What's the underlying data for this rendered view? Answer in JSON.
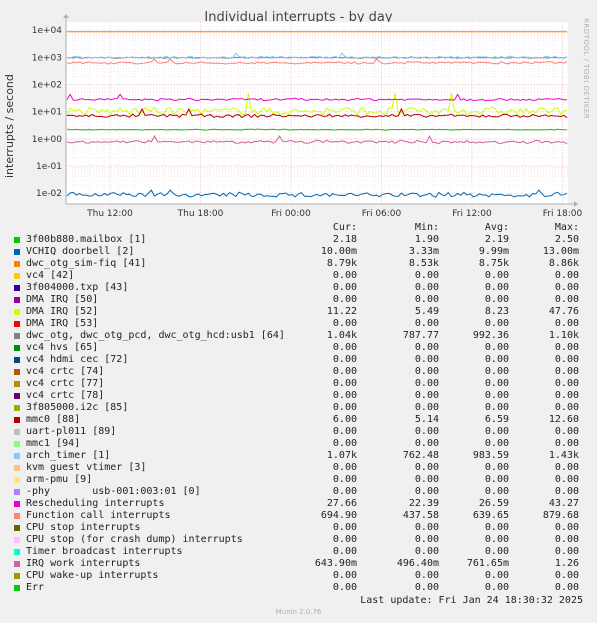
{
  "chart_data": {
    "type": "line",
    "title": "Individual interrupts - by day",
    "ylabel": "interrupts / second",
    "yscale": "log",
    "ylim": [
      0.004,
      20000
    ],
    "yticks": [
      "1e-02",
      "1e-01",
      "1e+00",
      "1e+01",
      "1e+02",
      "1e+03",
      "1e+04"
    ],
    "xticks": [
      "Thu 12:00",
      "Thu 18:00",
      "Fri 00:00",
      "Fri 06:00",
      "Fri 12:00",
      "Fri 18:00"
    ],
    "grid": true,
    "series": [
      {
        "name": "3f00b880.mailbox [1]",
        "color": "#00cc00",
        "values": [
          2.18,
          1.9,
          2.19,
          2.5
        ]
      },
      {
        "name": "VCHIQ doorbell [2]",
        "color": "#0066b3",
        "values": [
          0.01,
          0.00333,
          0.00999,
          0.013
        ]
      },
      {
        "name": "dwc_otg_sim-fiq [41]",
        "color": "#ff8000",
        "values": [
          8790,
          8530,
          8750,
          8860
        ]
      },
      {
        "name": "vc4 [42]",
        "color": "#ffcc00",
        "values": [
          0,
          0,
          0,
          0
        ]
      },
      {
        "name": "3f004000.txp [43]",
        "color": "#330099",
        "values": [
          0,
          0,
          0,
          0
        ]
      },
      {
        "name": "DMA IRQ [50]",
        "color": "#990099",
        "values": [
          0,
          0,
          0,
          0
        ]
      },
      {
        "name": "DMA IRQ [52]",
        "color": "#ccff00",
        "values": [
          11.22,
          5.49,
          8.23,
          47.76
        ]
      },
      {
        "name": "DMA IRQ [53]",
        "color": "#ff0000",
        "values": [
          0,
          0,
          0,
          0
        ]
      },
      {
        "name": "dwc_otg, dwc_otg_pcd, dwc_otg_hcd:usb1 [64]",
        "color": "#808080",
        "values": [
          1040,
          787.77,
          992.36,
          1100
        ]
      },
      {
        "name": "vc4 hvs [65]",
        "color": "#008f00",
        "values": [
          0,
          0,
          0,
          0
        ]
      },
      {
        "name": "vc4 hdmi cec [72]",
        "color": "#00487d",
        "values": [
          0,
          0,
          0,
          0
        ]
      },
      {
        "name": "vc4 crtc [74]",
        "color": "#b35a00",
        "values": [
          0,
          0,
          0,
          0
        ]
      },
      {
        "name": "vc4 crtc [77]",
        "color": "#b38f00",
        "values": [
          0,
          0,
          0,
          0
        ]
      },
      {
        "name": "vc4 crtc [78]",
        "color": "#6b006b",
        "values": [
          0,
          0,
          0,
          0
        ]
      },
      {
        "name": "3f805000.i2c [85]",
        "color": "#8fb300",
        "values": [
          0,
          0,
          0,
          0
        ]
      },
      {
        "name": "mmc0 [88]",
        "color": "#b30000",
        "values": [
          6.0,
          5.14,
          6.59,
          12.6
        ]
      },
      {
        "name": "uart-pl011 [89]",
        "color": "#bebebe",
        "values": [
          0,
          0,
          0,
          0
        ]
      },
      {
        "name": "mmc1 [94]",
        "color": "#80ff80",
        "values": [
          0,
          0,
          0,
          0
        ]
      },
      {
        "name": "arch_timer [1]",
        "color": "#80c9ff",
        "values": [
          1070,
          762.48,
          983.59,
          1430
        ]
      },
      {
        "name": "kvm guest vtimer [3]",
        "color": "#ffc080",
        "values": [
          0,
          0,
          0,
          0
        ]
      },
      {
        "name": "arm-pmu [9]",
        "color": "#ffe680",
        "values": [
          0,
          0,
          0,
          0
        ]
      },
      {
        "name": "-phy       usb-001:003:01 [0]",
        "color": "#aa80ff",
        "values": [
          0,
          0,
          0,
          0
        ]
      },
      {
        "name": "Rescheduling interrupts",
        "color": "#ee00cc",
        "values": [
          27.66,
          22.39,
          26.59,
          43.27
        ]
      },
      {
        "name": "Function call interrupts",
        "color": "#ff8080",
        "values": [
          694.9,
          437.58,
          639.65,
          879.68
        ]
      },
      {
        "name": "CPU stop interrupts",
        "color": "#666600",
        "values": [
          0,
          0,
          0,
          0
        ]
      },
      {
        "name": "CPU stop (for crash dump) interrupts",
        "color": "#ffbfff",
        "values": [
          0,
          0,
          0,
          0
        ]
      },
      {
        "name": "Timer broadcast interrupts",
        "color": "#00ffcc",
        "values": [
          0,
          0,
          0,
          0
        ]
      },
      {
        "name": "IRQ work interrupts",
        "color": "#cc6699",
        "values": [
          0.6439,
          0.4964,
          0.76165,
          1.26
        ]
      },
      {
        "name": "CPU wake-up interrupts",
        "color": "#999900",
        "values": [
          0,
          0,
          0,
          0
        ]
      },
      {
        "name": "Err",
        "color": "#00cc00",
        "values": [
          0,
          0,
          0,
          0
        ]
      }
    ]
  },
  "legend": {
    "headers": {
      "cur": "Cur:",
      "min": "Min:",
      "avg": "Avg:",
      "max": "Max:"
    },
    "rows": [
      {
        "name": "3f00b880.mailbox [1]",
        "cur": "2.18",
        "min": "1.90",
        "avg": "2.19",
        "max": "2.50"
      },
      {
        "name": "VCHIQ doorbell [2]",
        "cur": "10.00m",
        "min": "3.33m",
        "avg": "9.99m",
        "max": "13.00m"
      },
      {
        "name": "dwc_otg_sim-fiq [41]",
        "cur": "8.79k",
        "min": "8.53k",
        "avg": "8.75k",
        "max": "8.86k"
      },
      {
        "name": "vc4 [42]",
        "cur": "0.00",
        "min": "0.00",
        "avg": "0.00",
        "max": "0.00"
      },
      {
        "name": "3f004000.txp [43]",
        "cur": "0.00",
        "min": "0.00",
        "avg": "0.00",
        "max": "0.00"
      },
      {
        "name": "DMA IRQ [50]",
        "cur": "0.00",
        "min": "0.00",
        "avg": "0.00",
        "max": "0.00"
      },
      {
        "name": "DMA IRQ [52]",
        "cur": "11.22",
        "min": "5.49",
        "avg": "8.23",
        "max": "47.76"
      },
      {
        "name": "DMA IRQ [53]",
        "cur": "0.00",
        "min": "0.00",
        "avg": "0.00",
        "max": "0.00"
      },
      {
        "name": "dwc_otg, dwc_otg_pcd, dwc_otg_hcd:usb1 [64]",
        "cur": "1.04k",
        "min": "787.77",
        "avg": "992.36",
        "max": "1.10k"
      },
      {
        "name": "vc4 hvs [65]",
        "cur": "0.00",
        "min": "0.00",
        "avg": "0.00",
        "max": "0.00"
      },
      {
        "name": "vc4 hdmi cec [72]",
        "cur": "0.00",
        "min": "0.00",
        "avg": "0.00",
        "max": "0.00"
      },
      {
        "name": "vc4 crtc [74]",
        "cur": "0.00",
        "min": "0.00",
        "avg": "0.00",
        "max": "0.00"
      },
      {
        "name": "vc4 crtc [77]",
        "cur": "0.00",
        "min": "0.00",
        "avg": "0.00",
        "max": "0.00"
      },
      {
        "name": "vc4 crtc [78]",
        "cur": "0.00",
        "min": "0.00",
        "avg": "0.00",
        "max": "0.00"
      },
      {
        "name": "3f805000.i2c [85]",
        "cur": "0.00",
        "min": "0.00",
        "avg": "0.00",
        "max": "0.00"
      },
      {
        "name": "mmc0 [88]",
        "cur": "6.00",
        "min": "5.14",
        "avg": "6.59",
        "max": "12.60"
      },
      {
        "name": "uart-pl011 [89]",
        "cur": "0.00",
        "min": "0.00",
        "avg": "0.00",
        "max": "0.00"
      },
      {
        "name": "mmc1 [94]",
        "cur": "0.00",
        "min": "0.00",
        "avg": "0.00",
        "max": "0.00"
      },
      {
        "name": "arch_timer [1]",
        "cur": "1.07k",
        "min": "762.48",
        "avg": "983.59",
        "max": "1.43k"
      },
      {
        "name": "kvm guest vtimer [3]",
        "cur": "0.00",
        "min": "0.00",
        "avg": "0.00",
        "max": "0.00"
      },
      {
        "name": "arm-pmu [9]",
        "cur": "0.00",
        "min": "0.00",
        "avg": "0.00",
        "max": "0.00"
      },
      {
        "name": "-phy       usb-001:003:01 [0]",
        "cur": "0.00",
        "min": "0.00",
        "avg": "0.00",
        "max": "0.00"
      },
      {
        "name": "Rescheduling interrupts",
        "cur": "27.66",
        "min": "22.39",
        "avg": "26.59",
        "max": "43.27"
      },
      {
        "name": "Function call interrupts",
        "cur": "694.90",
        "min": "437.58",
        "avg": "639.65",
        "max": "879.68"
      },
      {
        "name": "CPU stop interrupts",
        "cur": "0.00",
        "min": "0.00",
        "avg": "0.00",
        "max": "0.00"
      },
      {
        "name": "CPU stop (for crash dump) interrupts",
        "cur": "0.00",
        "min": "0.00",
        "avg": "0.00",
        "max": "0.00"
      },
      {
        "name": "Timer broadcast interrupts",
        "cur": "0.00",
        "min": "0.00",
        "avg": "0.00",
        "max": "0.00"
      },
      {
        "name": "IRQ work interrupts",
        "cur": "643.90m",
        "min": "496.40m",
        "avg": "761.65m",
        "max": "1.26"
      },
      {
        "name": "CPU wake-up interrupts",
        "cur": "0.00",
        "min": "0.00",
        "avg": "0.00",
        "max": "0.00"
      },
      {
        "name": "Err",
        "cur": "0.00",
        "min": "0.00",
        "avg": "0.00",
        "max": "0.00"
      }
    ]
  },
  "last_update": "Last update: Fri Jan 24 18:30:32 2025",
  "munin_version": "Munin 2.0.76",
  "watermark": "RRDTOOL / TOBI OETIKER"
}
